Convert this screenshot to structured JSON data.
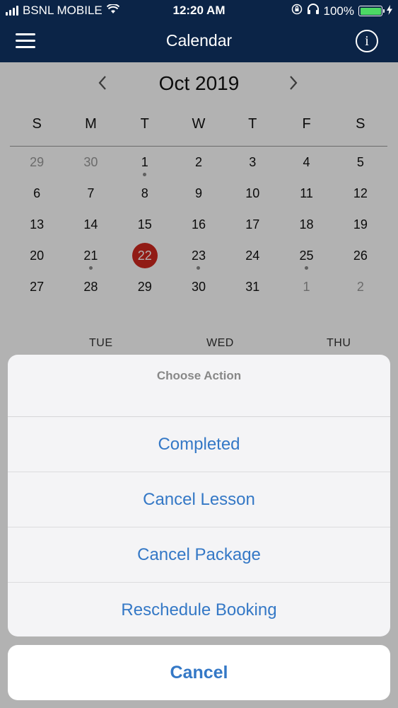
{
  "status_bar": {
    "carrier": "BSNL MOBILE",
    "time": "12:20 AM",
    "battery": "100%"
  },
  "nav": {
    "title": "Calendar",
    "info_glyph": "i"
  },
  "calendar": {
    "month_label": "Oct 2019",
    "prev_glyph": "<",
    "next_glyph": ">",
    "days_of_week": [
      "S",
      "M",
      "T",
      "W",
      "T",
      "F",
      "S"
    ],
    "weeks": [
      [
        {
          "d": "29",
          "muted": true
        },
        {
          "d": "30",
          "muted": true
        },
        {
          "d": "1",
          "dot": true
        },
        {
          "d": "2"
        },
        {
          "d": "3"
        },
        {
          "d": "4"
        },
        {
          "d": "5"
        }
      ],
      [
        {
          "d": "6"
        },
        {
          "d": "7"
        },
        {
          "d": "8"
        },
        {
          "d": "9"
        },
        {
          "d": "10"
        },
        {
          "d": "11"
        },
        {
          "d": "12"
        }
      ],
      [
        {
          "d": "13"
        },
        {
          "d": "14"
        },
        {
          "d": "15"
        },
        {
          "d": "16"
        },
        {
          "d": "17"
        },
        {
          "d": "18"
        },
        {
          "d": "19"
        }
      ],
      [
        {
          "d": "20"
        },
        {
          "d": "21",
          "dot": true
        },
        {
          "d": "22",
          "today": true
        },
        {
          "d": "23",
          "dot": true
        },
        {
          "d": "24"
        },
        {
          "d": "25",
          "dot": true
        },
        {
          "d": "26"
        }
      ],
      [
        {
          "d": "27"
        },
        {
          "d": "28"
        },
        {
          "d": "29"
        },
        {
          "d": "30"
        },
        {
          "d": "31"
        },
        {
          "d": "1",
          "muted": true
        },
        {
          "d": "2",
          "muted": true
        }
      ]
    ],
    "week_header": [
      "TUE",
      "WED",
      "THU"
    ]
  },
  "action_sheet": {
    "title": "Choose Action",
    "buttons": [
      "Completed",
      "Cancel Lesson",
      "Cancel Package",
      "Reschedule Booking"
    ],
    "cancel_label": "Cancel"
  },
  "colors": {
    "nav_bg": "#0b2447",
    "today_circle": "#d0281f",
    "action_blue": "#3478c6"
  }
}
